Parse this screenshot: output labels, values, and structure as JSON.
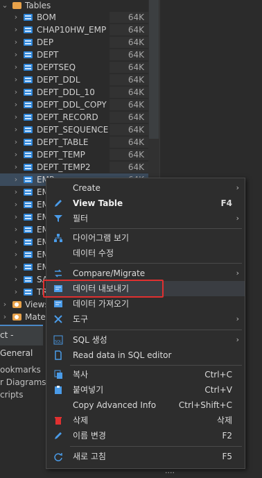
{
  "tree": {
    "folder_label": "Tables",
    "tables": [
      {
        "name": "BOM",
        "size": "64K"
      },
      {
        "name": "CHAP10HW_EMP",
        "size": "64K"
      },
      {
        "name": "DEP",
        "size": "64K"
      },
      {
        "name": "DEPT",
        "size": "64K"
      },
      {
        "name": "DEPTSEQ",
        "size": "64K"
      },
      {
        "name": "DEPT_DDL",
        "size": "64K"
      },
      {
        "name": "DEPT_DDL_10",
        "size": "64K"
      },
      {
        "name": "DEPT_DDL_COPY",
        "size": "64K"
      },
      {
        "name": "DEPT_RECORD",
        "size": "64K"
      },
      {
        "name": "DEPT_SEQUENCE",
        "size": "64K"
      },
      {
        "name": "DEPT_TABLE",
        "size": "64K"
      },
      {
        "name": "DEPT_TEMP",
        "size": "64K"
      },
      {
        "name": "DEPT_TEMP2",
        "size": "64K"
      },
      {
        "name": "EMP",
        "size": "64K"
      },
      {
        "name": "EM",
        "size": ""
      },
      {
        "name": "EM",
        "size": ""
      },
      {
        "name": "EM",
        "size": ""
      },
      {
        "name": "EM",
        "size": ""
      },
      {
        "name": "EM",
        "size": ""
      },
      {
        "name": "EM",
        "size": ""
      },
      {
        "name": "EM",
        "size": ""
      },
      {
        "name": "SA",
        "size": ""
      },
      {
        "name": "TR",
        "size": ""
      }
    ],
    "views_label": "Views",
    "materialized_label": "Mater"
  },
  "project_panel": {
    "tab_label": "ct - General",
    "items": [
      "ookmarks",
      "r Diagrams",
      "cripts"
    ]
  },
  "context_menu": {
    "items": [
      {
        "label": "Create",
        "shortcut": "",
        "submenu": true,
        "icon": ""
      },
      {
        "label": "View Table",
        "shortcut": "F4",
        "submenu": false,
        "icon": "pencil-icon"
      },
      {
        "label": "필터",
        "shortcut": "",
        "submenu": true,
        "icon": "filter-icon"
      },
      {
        "label": "다이어그램 보기",
        "shortcut": "",
        "submenu": false,
        "icon": "diagram-icon"
      },
      {
        "label": "데이터 수정",
        "shortcut": "",
        "submenu": false,
        "icon": ""
      },
      {
        "label": "Compare/Migrate",
        "shortcut": "",
        "submenu": true,
        "icon": "compare-icon"
      },
      {
        "label": "데이터 내보내기",
        "shortcut": "",
        "submenu": false,
        "icon": "export-icon"
      },
      {
        "label": "데이터 가져오기",
        "shortcut": "",
        "submenu": false,
        "icon": "import-icon"
      },
      {
        "label": "도구",
        "shortcut": "",
        "submenu": true,
        "icon": "tools-icon"
      },
      {
        "label": "SQL 생성",
        "shortcut": "",
        "submenu": true,
        "icon": "sql-icon"
      },
      {
        "label": "Read data in SQL editor",
        "shortcut": "",
        "submenu": false,
        "icon": "document-icon"
      },
      {
        "label": "복사",
        "shortcut": "Ctrl+C",
        "submenu": false,
        "icon": "copy-icon"
      },
      {
        "label": "붙여넣기",
        "shortcut": "Ctrl+V",
        "submenu": false,
        "icon": "paste-icon"
      },
      {
        "label": "Copy Advanced Info",
        "shortcut": "Ctrl+Shift+C",
        "submenu": false,
        "icon": ""
      },
      {
        "label": "삭제",
        "shortcut": "삭제",
        "submenu": false,
        "icon": "delete-icon"
      },
      {
        "label": "이름 변경",
        "shortcut": "F2",
        "submenu": false,
        "icon": "rename-icon"
      },
      {
        "label": "새로 고침",
        "shortcut": "F5",
        "submenu": false,
        "icon": "refresh-icon"
      }
    ]
  },
  "status": {
    "ellipsis": "...."
  },
  "colors": {
    "highlight_border": "#e03030",
    "table_icon": "#2f86d8",
    "folder_icon": "#e8a24a"
  }
}
